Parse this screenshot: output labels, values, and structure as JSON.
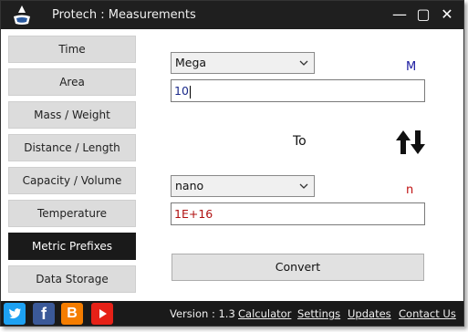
{
  "window": {
    "title": "Protech : Measurements",
    "controls": {
      "minimize": "—",
      "maximize": "▢",
      "close": "✕"
    }
  },
  "sidebar": {
    "items": [
      {
        "label": "Time",
        "active": false
      },
      {
        "label": "Area",
        "active": false
      },
      {
        "label": "Mass / Weight",
        "active": false
      },
      {
        "label": "Distance / Length",
        "active": false
      },
      {
        "label": "Capacity / Volume",
        "active": false
      },
      {
        "label": "Temperature",
        "active": false
      },
      {
        "label": "Metric Prefixes",
        "active": true
      },
      {
        "label": "Data Storage",
        "active": false
      }
    ]
  },
  "converter": {
    "from_unit": "Mega",
    "from_symbol": "M",
    "from_value": "10",
    "to_label": "To",
    "to_unit": "nano",
    "to_symbol": "n",
    "to_value": "1E+16",
    "convert_label": "Convert"
  },
  "footer": {
    "version": "Version : 1.3",
    "links": [
      "Calculator",
      "Settings",
      "Updates",
      "Contact Us"
    ],
    "social": [
      "twitter-icon",
      "facebook-icon",
      "blogger-icon",
      "youtube-icon"
    ]
  },
  "colors": {
    "titlebar_bg": "#1f1f1f",
    "active_nav_bg": "#1a1a1a",
    "input_value": "#1a2a8a",
    "output_value": "#b01010",
    "from_symbol": "#1a1aa0",
    "to_symbol": "#c01010"
  }
}
